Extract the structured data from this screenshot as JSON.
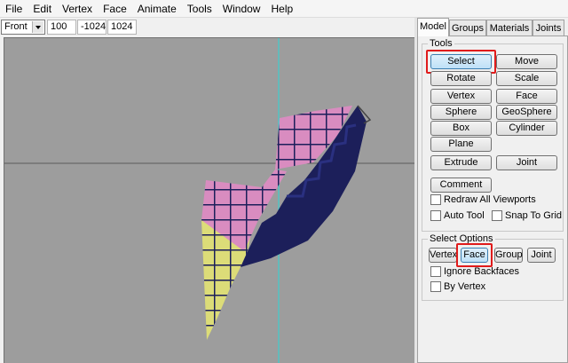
{
  "menu": [
    "File",
    "Edit",
    "Vertex",
    "Face",
    "Animate",
    "Tools",
    "Window",
    "Help"
  ],
  "toolbar": {
    "view": "Front",
    "coord1": "100",
    "coord2": "-1024",
    "coord3": "1024"
  },
  "tabs": [
    "Model",
    "Groups",
    "Materials",
    "Joints"
  ],
  "tools": {
    "label": "Tools",
    "select": "Select",
    "move": "Move",
    "rotate": "Rotate",
    "scale": "Scale",
    "vertex": "Vertex",
    "face": "Face",
    "sphere": "Sphere",
    "geosphere": "GeoSphere",
    "box": "Box",
    "cylinder": "Cylinder",
    "plane": "Plane",
    "extrude": "Extrude",
    "joint": "Joint",
    "comment": "Comment",
    "redraw": "Redraw All Viewports",
    "auto_tool": "Auto Tool",
    "snap_grid": "Snap To Grid"
  },
  "select_options": {
    "label": "Select Options",
    "vertex": "Vertex",
    "face": "Face",
    "group": "Group",
    "joint": "Joint",
    "ignore_backfaces": "Ignore Backfaces",
    "by_vertex": "By Vertex"
  },
  "colors": {
    "viewport_bg": "#9d9d9d",
    "pink": "#d98cc0",
    "yellow": "#dcdc78",
    "navy": "#1c1f5a",
    "axis_line": "#2bd6d6",
    "highlight": "#e01b1b"
  }
}
